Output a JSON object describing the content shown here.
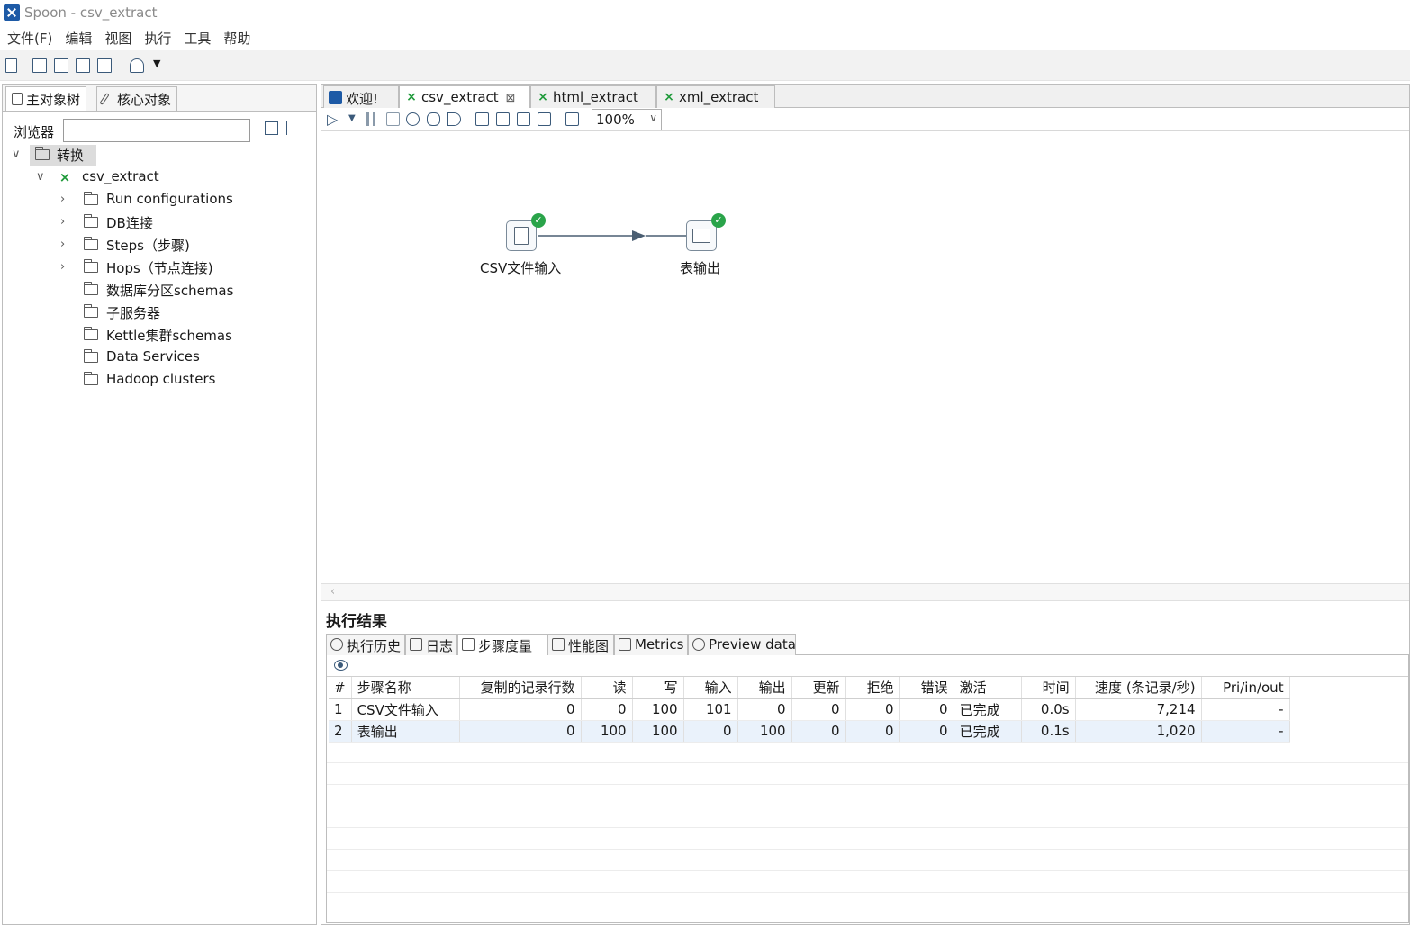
{
  "window": {
    "title": "Spoon - csv_extract"
  },
  "menubar": {
    "items": [
      "文件(F)",
      "编辑",
      "视图",
      "执行",
      "工具",
      "帮助"
    ]
  },
  "left": {
    "tabs": [
      "主对象树",
      "核心对象"
    ],
    "browser_label": "浏览器",
    "browser_value": "",
    "tree": {
      "root": "转换",
      "transform": "csv_extract",
      "items": [
        "Run configurations",
        "DB连接",
        "Steps（步骤)",
        "Hops（节点连接)",
        "数据库分区schemas",
        "子服务器",
        "Kettle集群schemas",
        "Data Services",
        "Hadoop clusters"
      ]
    }
  },
  "editor": {
    "tabs": [
      "欢迎!",
      "csv_extract",
      "html_extract",
      "xml_extract"
    ],
    "active_tab": "csv_extract",
    "zoom": "100%"
  },
  "canvas": {
    "steps": [
      {
        "name": "CSV文件输入",
        "status": "success"
      },
      {
        "name": "表输出",
        "status": "success"
      }
    ]
  },
  "results": {
    "title": "执行结果",
    "tabs": [
      "执行历史",
      "日志",
      "步骤度量",
      "性能图",
      "Metrics",
      "Preview data"
    ],
    "active_tab": "步骤度量",
    "columns": [
      "#",
      "步骤名称",
      "复制的记录行数",
      "读",
      "写",
      "输入",
      "输出",
      "更新",
      "拒绝",
      "错误",
      "激活",
      "时间",
      "速度 (条记录/秒)",
      "Pri/in/out"
    ],
    "rows": [
      [
        "1",
        "CSV文件输入",
        "0",
        "0",
        "100",
        "101",
        "0",
        "0",
        "0",
        "0",
        "已完成",
        "0.0s",
        "7,214",
        "-"
      ],
      [
        "2",
        "表输出",
        "0",
        "100",
        "100",
        "0",
        "100",
        "0",
        "0",
        "0",
        "已完成",
        "0.1s",
        "1,020",
        "-"
      ]
    ]
  },
  "colors": {
    "accent": "#1d5aa6",
    "success": "#2aa44a",
    "transform_icon": "#1f9a3a"
  }
}
